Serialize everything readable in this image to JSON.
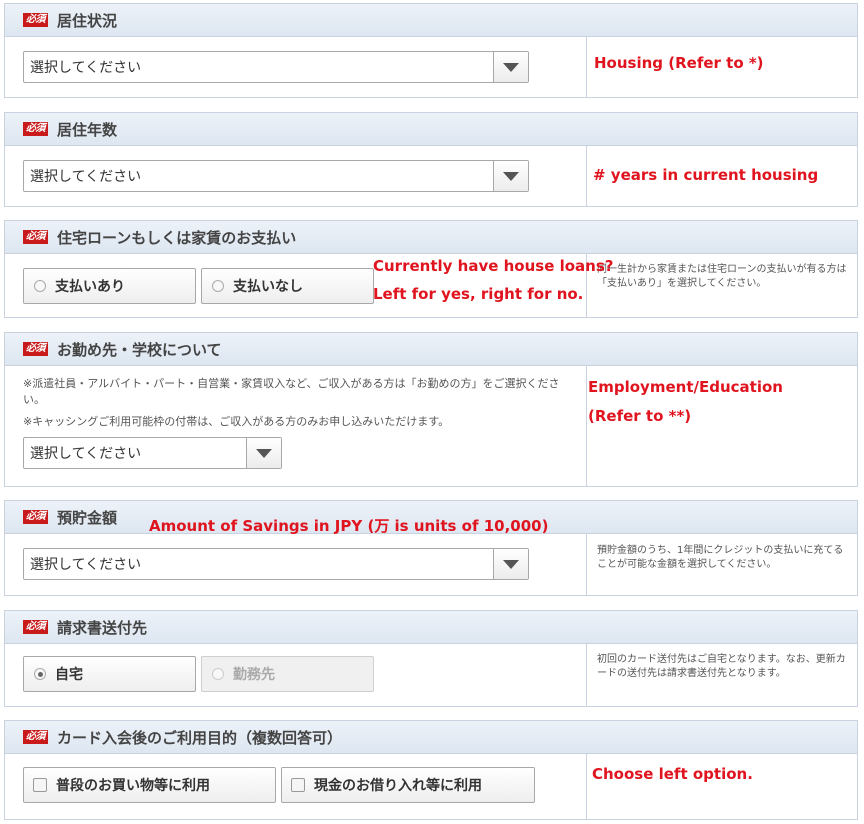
{
  "badge_label": "必須",
  "sections": [
    {
      "title": "居住状況",
      "select_value": "選択してください",
      "annotation": "Housing (Refer to *)"
    },
    {
      "title": "居住年数",
      "select_value": "選択してください",
      "annotation": "# years in current housing"
    },
    {
      "title": "住宅ローンもしくは家賃のお支払い",
      "options": [
        "支払いあり",
        "支払いなし"
      ],
      "annotation_line1": "Currently have house loans?",
      "annotation_line2": "Left for yes, right for no.",
      "note": "同一生計から家賃または住宅ローンの支払いが有る方は「支払いあり」を選択してください。"
    },
    {
      "title": "お勤め先・学校について",
      "note1": "※派遣社員・アルバイト・パート・自営業・家賃収入など、ご収入がある方は「お勤めの方」をご選択ください。",
      "note2": "※キャッシングご利用可能枠の付帯は、ご収入がある方のみお申し込みいただけます。",
      "select_value": "選択してください",
      "annotation_line1": "Employment/Education",
      "annotation_line2": "(Refer to **)"
    },
    {
      "title": "預貯金額",
      "select_value": "選択してください",
      "annotation": "Amount of Savings in JPY (万 is units of 10,000)",
      "note": "預貯金額のうち、1年間にクレジットの支払いに充てることが可能な金額を選択してください。"
    },
    {
      "title": "請求書送付先",
      "options": [
        "自宅",
        "勤務先"
      ],
      "note": "初回のカード送付先はご自宅となります。なお、更新カードの送付先は請求書送付先となります。"
    },
    {
      "title": "カード入会後のご利用目的（複数回答可）",
      "options": [
        "普段のお買い物等に利用",
        "現金のお借り入れ等に利用"
      ],
      "annotation": "Choose left option."
    }
  ]
}
